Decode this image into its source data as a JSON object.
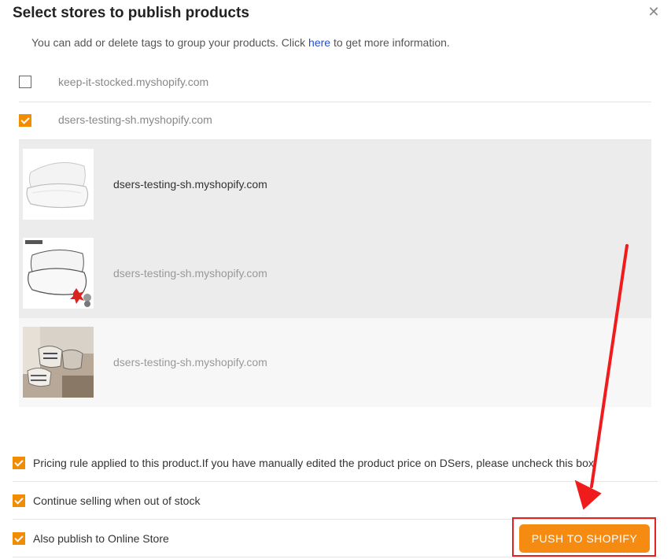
{
  "dialog": {
    "title": "Select stores to publish products",
    "info_prefix": "You can add or delete tags to group your products. Click ",
    "info_link": "here",
    "info_suffix": " to get more information."
  },
  "stores": [
    {
      "label": "keep-it-stocked.myshopify.com",
      "checked": false
    },
    {
      "label": "dsers-testing-sh.myshopify.com",
      "checked": true
    }
  ],
  "products": [
    {
      "store": "dsers-testing-sh.myshopify.com",
      "image": "pillow-pair-image"
    },
    {
      "store": "dsers-testing-sh.myshopify.com",
      "image": "pillow-product-image"
    },
    {
      "store": "dsers-testing-sh.myshopify.com",
      "image": "pillows-lifestyle-image"
    }
  ],
  "options": [
    {
      "label": "Pricing rule applied to this product.If you have manually edited the product price on DSers, please uncheck this box.",
      "checked": true
    },
    {
      "label": "Continue selling when out of stock",
      "checked": true
    },
    {
      "label": "Also publish to Online Store",
      "checked": true
    }
  ],
  "push_button": {
    "label": "PUSH TO SHOPIFY"
  },
  "colors": {
    "accent": "#f28c00",
    "button": "#f68b12",
    "highlight": "#e82020",
    "link": "#1f4ed8"
  }
}
